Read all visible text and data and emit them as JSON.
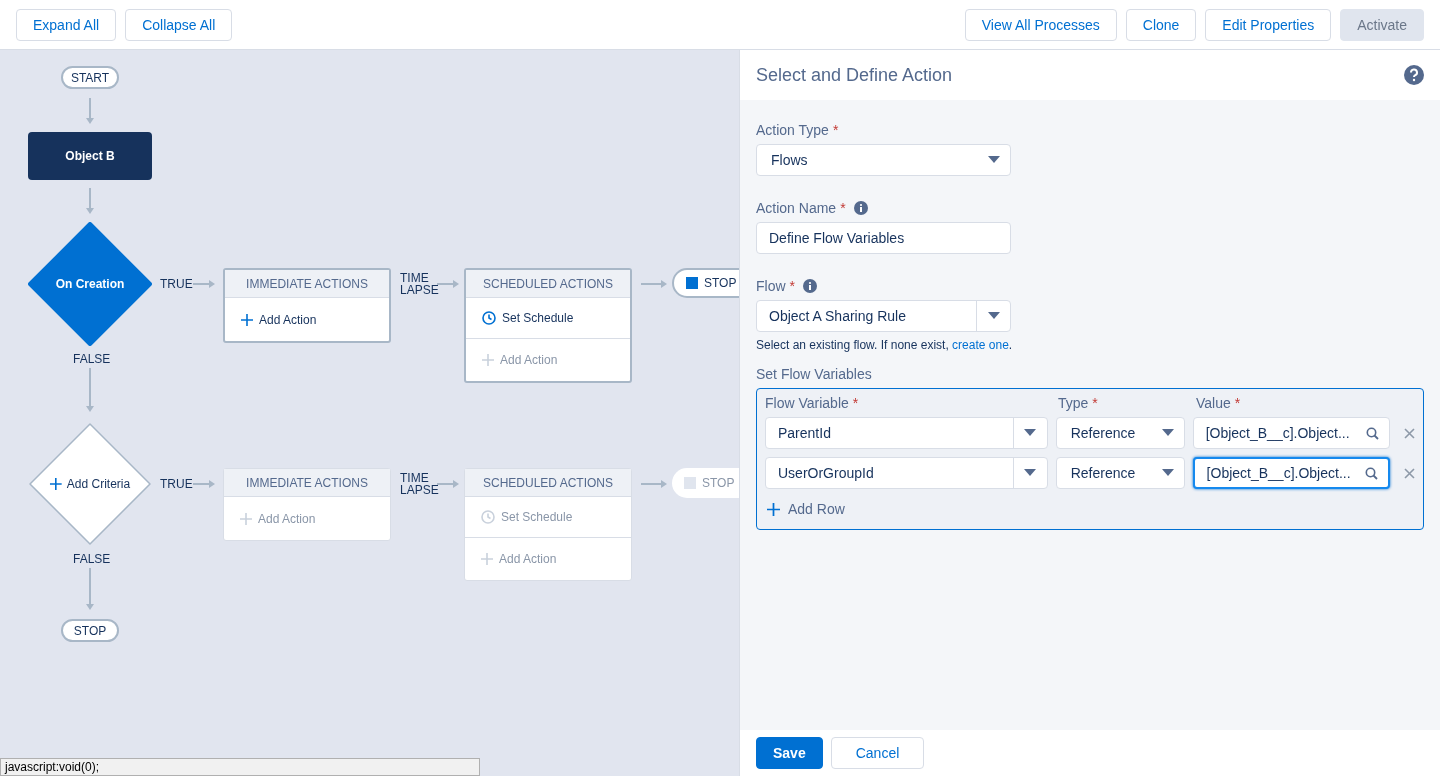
{
  "toolbar": {
    "left": [
      {
        "label": "Expand All",
        "disabled": false
      },
      {
        "label": "Collapse All",
        "disabled": false
      }
    ],
    "right": [
      {
        "label": "View All Processes",
        "disabled": false
      },
      {
        "label": "Clone",
        "disabled": false
      },
      {
        "label": "Edit Properties",
        "disabled": false
      },
      {
        "label": "Activate",
        "disabled": true
      }
    ]
  },
  "canvas": {
    "start": "START",
    "object": "Object B",
    "end": "STOP",
    "criteria": [
      {
        "kind": "defined",
        "label": "On Creation",
        "true_label": "TRUE",
        "false_label": "FALSE",
        "immediate": {
          "title": "IMMEDIATE ACTIONS",
          "add_action": "Add Action",
          "disabled": false
        },
        "time_lapse": "TIME LAPSE",
        "scheduled": {
          "title": "SCHEDULED ACTIONS",
          "set_schedule": "Set Schedule",
          "add_action": "Add Action",
          "schedule_disabled": false,
          "add_disabled": true
        },
        "stop": {
          "label": "STOP",
          "disabled": false
        }
      },
      {
        "kind": "add",
        "label": "Add Criteria",
        "true_label": "TRUE",
        "false_label": "FALSE",
        "immediate": {
          "title": "IMMEDIATE ACTIONS",
          "add_action": "Add Action",
          "disabled": true
        },
        "time_lapse": "TIME LAPSE",
        "scheduled": {
          "title": "SCHEDULED ACTIONS",
          "set_schedule": "Set Schedule",
          "add_action": "Add Action",
          "schedule_disabled": true,
          "add_disabled": true
        },
        "stop": {
          "label": "STOP",
          "disabled": true
        }
      }
    ]
  },
  "status_bar": "javascript:void(0);",
  "panel": {
    "title": "Select and Define Action",
    "action_type": {
      "label": "Action Type",
      "required": "*",
      "value": "Flows"
    },
    "action_name": {
      "label": "Action Name",
      "required": "*",
      "value": "Define Flow Variables"
    },
    "flow": {
      "label": "Flow",
      "required": "*",
      "value": "Object A Sharing Rule",
      "hint": "Select an existing flow. If none exist, ",
      "hint_link": "create one",
      "hint_end": "."
    },
    "variables": {
      "label": "Set Flow Variables",
      "columns": [
        {
          "label": "Flow Variable",
          "required": "*"
        },
        {
          "label": "Type",
          "required": "*"
        },
        {
          "label": "Value",
          "required": "*"
        }
      ],
      "rows": [
        {
          "variable": "ParentId",
          "type": "Reference",
          "value": "[Object_B__c].Object...",
          "focused": false
        },
        {
          "variable": "UserOrGroupId",
          "type": "Reference",
          "value": "[Object_B__c].Object...",
          "focused": true
        }
      ],
      "add_row": "Add Row"
    },
    "buttons": [
      {
        "label": "Save",
        "kind": "primary"
      },
      {
        "label": "Cancel",
        "kind": "neutral"
      }
    ]
  }
}
